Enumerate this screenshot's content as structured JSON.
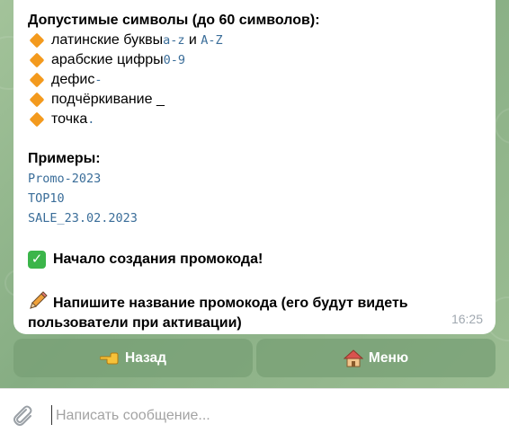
{
  "message": {
    "heading": "Допустимые символы (до 60 символов):",
    "rules": [
      {
        "text": "латинские буквы ",
        "code1": "a-z",
        "joiner": " и ",
        "code2": "A-Z"
      },
      {
        "text": "арабские цифры ",
        "code1": "0-9"
      },
      {
        "text": "дефис ",
        "code1": "-"
      },
      {
        "text": "подчёркивание _"
      },
      {
        "text": "точка ",
        "code1": "."
      }
    ],
    "examples_heading": "Примеры:",
    "examples": [
      "Promo-2023",
      "TOP10",
      "SALE_23.02.2023"
    ],
    "start_text": "Начало создания промокода!",
    "prompt_text": "Напишите название промокода (его будут видеть пользователи при активации)",
    "time": "16:25"
  },
  "keyboard": {
    "back_label": "Назад",
    "menu_label": "Меню",
    "back_icon": "pointing-hand-icon",
    "menu_icon": "house-icon"
  },
  "input": {
    "placeholder": "Написать сообщение..."
  },
  "colors": {
    "accent_code": "#3a6d99",
    "chat_background": "#8fb48c",
    "button_background": "#78a076",
    "rule_marker": "#f39a1e"
  }
}
